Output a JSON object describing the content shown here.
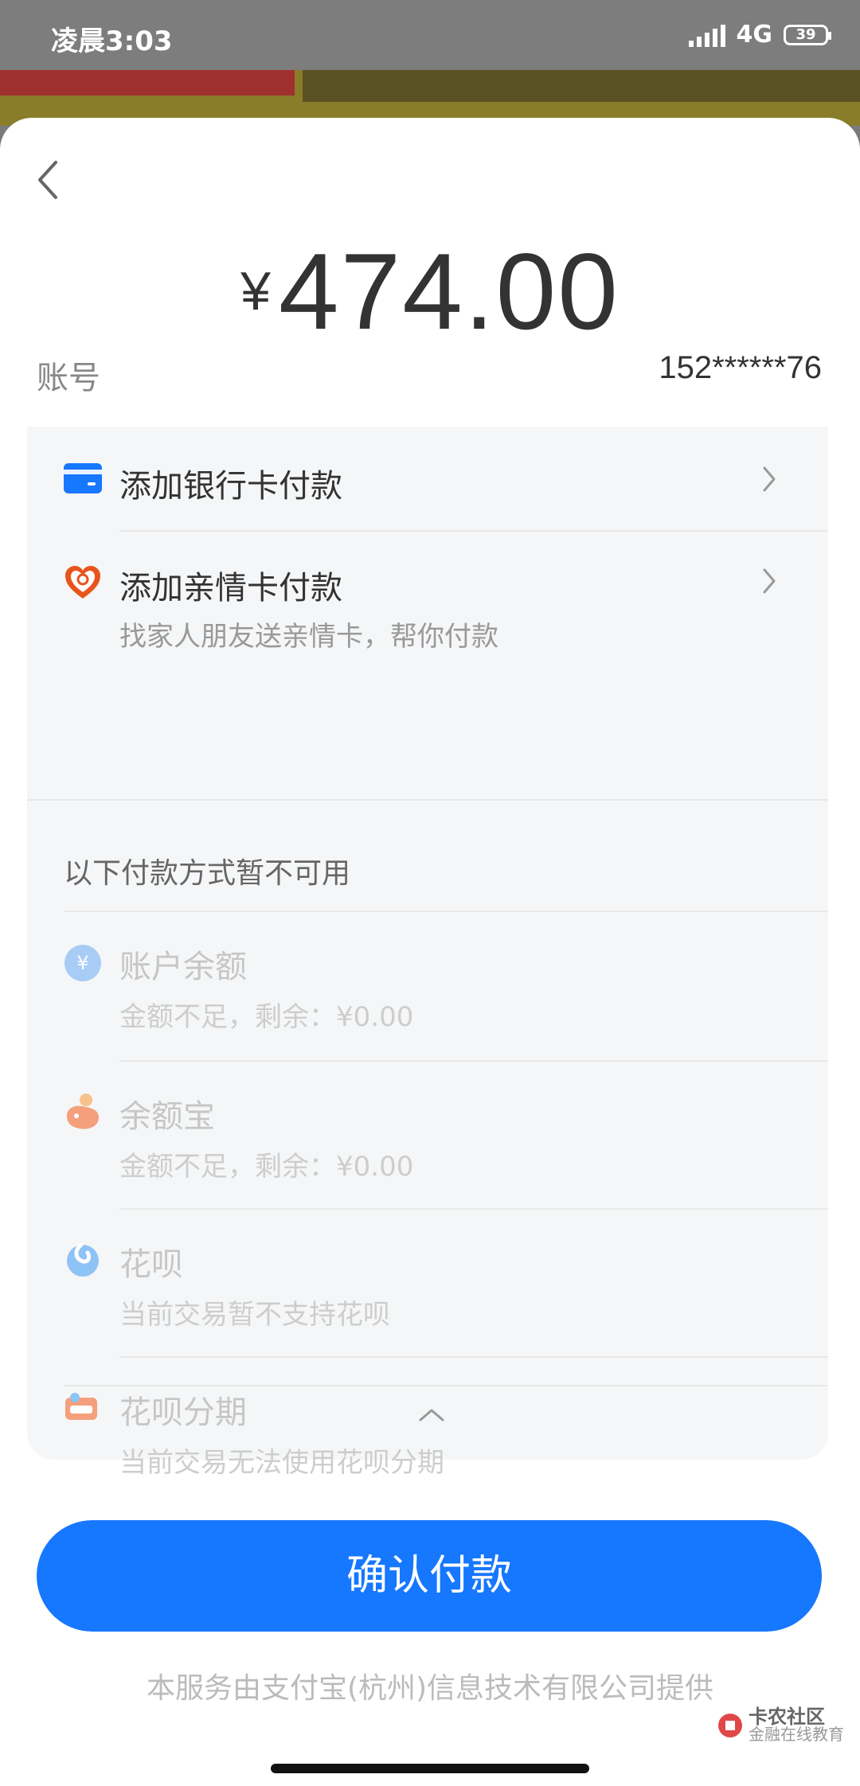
{
  "status_bar": {
    "time": "凌晨3:03",
    "network": "4G",
    "battery": "39"
  },
  "payment": {
    "currency_symbol": "¥",
    "amount": "474.00",
    "account_label": "账号",
    "account_value": "152******76"
  },
  "methods": {
    "add_bank_card": {
      "title": "添加银行卡付款",
      "icon": "bank-card-icon"
    },
    "add_family_card": {
      "title": "添加亲情卡付款",
      "subtitle": "找家人朋友送亲情卡，帮你付款",
      "icon": "heart-card-icon"
    },
    "unavailable_label": "以下付款方式暂不可用",
    "unavailable": [
      {
        "title": "账户余额",
        "subtitle": "金额不足，剩余：¥0.00",
        "icon": "balance-icon"
      },
      {
        "title": "余额宝",
        "subtitle": "金额不足，剩余：¥0.00",
        "icon": "yuebao-icon"
      },
      {
        "title": "花呗",
        "subtitle": "当前交易暂不支持花呗",
        "icon": "huabei-icon"
      },
      {
        "title": "花呗分期",
        "subtitle": "当前交易无法使用花呗分期",
        "icon": "huabei-installment-icon"
      }
    ]
  },
  "confirm_label": "确认付款",
  "footer_text": "本服务由支付宝(杭州)信息技术有限公司提供",
  "watermark": {
    "title": "卡农社区",
    "subtitle": "金融在线教育"
  },
  "colors": {
    "primary": "#1677ff",
    "bank_icon": "#1677ff",
    "heart_icon": "#e8541c"
  }
}
